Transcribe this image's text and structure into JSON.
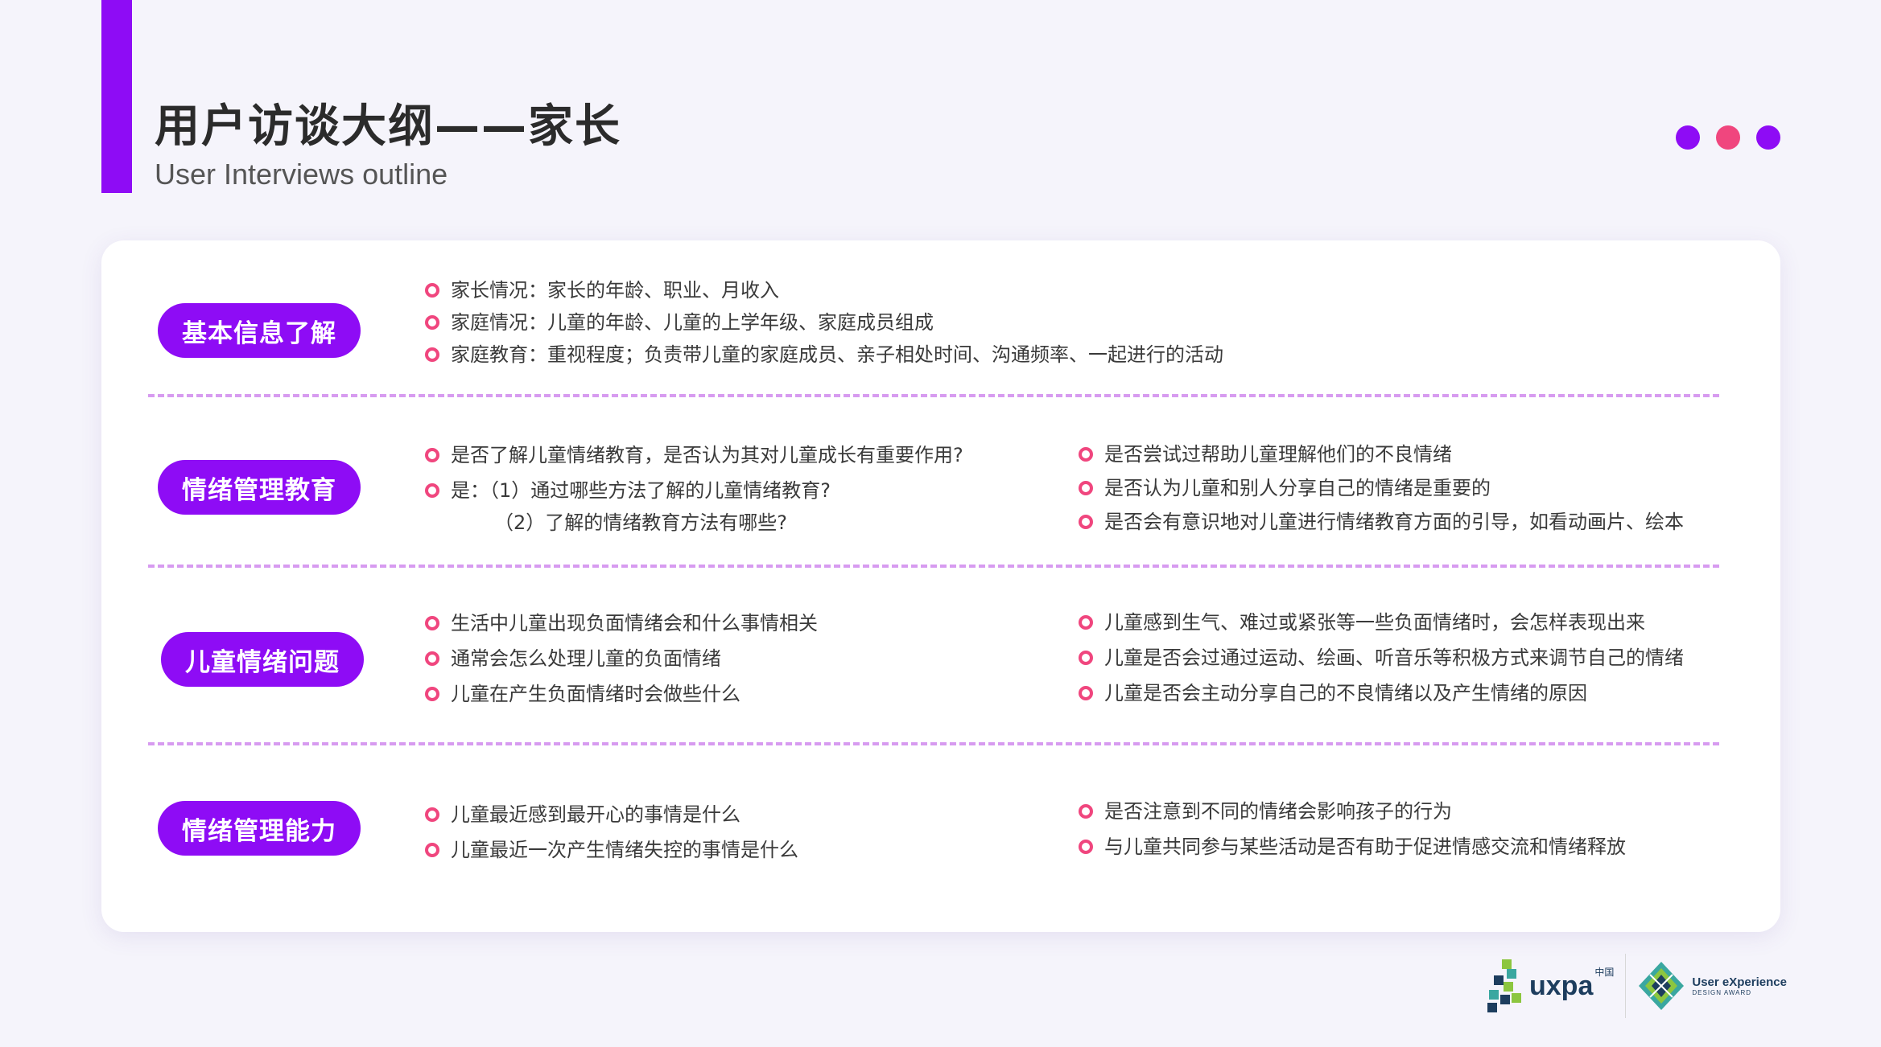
{
  "header": {
    "title": "用户访谈大纲——家长",
    "subtitle": "User Interviews outline",
    "dot_colors": [
      "#8e0cf5",
      "#f0467e",
      "#8e0cf5"
    ]
  },
  "sections": [
    {
      "label": "基本信息了解",
      "left_items": [
        "家长情况：家长的年龄、职业、月收入",
        "家庭情况：儿童的年龄、儿童的上学年级、家庭成员组成",
        "家庭教育：重视程度；负责带儿童的家庭成员、亲子相处时间、沟通频率、一起进行的活动"
      ]
    },
    {
      "label": "情绪管理教育",
      "left_items": [
        "是否了解儿童情绪教育，是否认为其对儿童成长有重要作用?",
        "是：（1）通过哪些方法了解的儿童情绪教育?"
      ],
      "left_continuation": "（2）了解的情绪教育方法有哪些?",
      "right_items": [
        "是否尝试过帮助儿童理解他们的不良情绪",
        "是否认为儿童和别人分享自己的情绪是重要的",
        "是否会有意识地对儿童进行情绪教育方面的引导，如看动画片、绘本"
      ]
    },
    {
      "label": "儿童情绪问题",
      "left_items": [
        "生活中儿童出现负面情绪会和什么事情相关",
        "通常会怎么处理儿童的负面情绪",
        "儿童在产生负面情绪时会做些什么"
      ],
      "right_items": [
        "儿童感到生气、难过或紧张等一些负面情绪时，会怎样表现出来",
        "儿童是否会过通过运动、绘画、听音乐等积极方式来调节自己的情绪",
        "儿童是否会主动分享自己的不良情绪以及产生情绪的原因"
      ]
    },
    {
      "label": "情绪管理能力",
      "left_items": [
        "儿童最近感到最开心的事情是什么",
        "儿童最近一次产生情绪失控的事情是什么"
      ],
      "right_items": [
        "是否注意到不同的情绪会影响孩子的行为",
        "与儿童共同参与某些活动是否有助于促进情感交流和情绪释放"
      ]
    }
  ],
  "logos": {
    "uxpa": "uxpa",
    "uxpa_cn": "中国",
    "award_line1": "User eXperience",
    "award_line2": "DESIGN AWARD"
  },
  "colors": {
    "accent": "#8e0cf5",
    "bullet": "#f0467e",
    "divider": "#d79bf0"
  }
}
